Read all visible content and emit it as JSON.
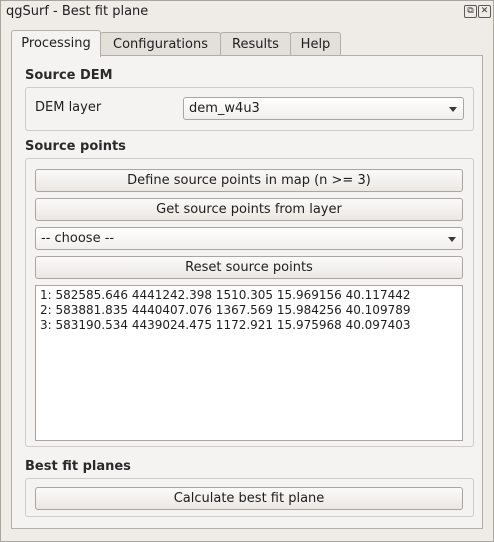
{
  "window": {
    "title": "qgSurf - Best fit plane",
    "float_glyph": "⧉",
    "close_glyph": "✕"
  },
  "tabs": [
    {
      "label": "Processing",
      "active": true
    },
    {
      "label": "Configurations",
      "active": false
    },
    {
      "label": "Results",
      "active": false
    },
    {
      "label": "Help",
      "active": false
    }
  ],
  "source_dem": {
    "heading": "Source DEM",
    "dem_layer_label": "DEM layer",
    "dem_layer_value": "dem_w4u3"
  },
  "source_points": {
    "heading": "Source points",
    "define_button": "Define source points in map (n >= 3)",
    "get_button": "Get source points from layer",
    "layer_combo_value": "--  choose  --",
    "reset_button": "Reset source points",
    "points": [
      "1: 582585.646 4441242.398 1510.305 15.969156 40.117442",
      "2: 583881.835 4440407.076 1367.569 15.984256 40.109789",
      "3: 583190.534 4439024.475 1172.921 15.975968 40.097403"
    ]
  },
  "best_fit": {
    "heading": "Best fit planes",
    "calculate_button": "Calculate best fit plane"
  }
}
